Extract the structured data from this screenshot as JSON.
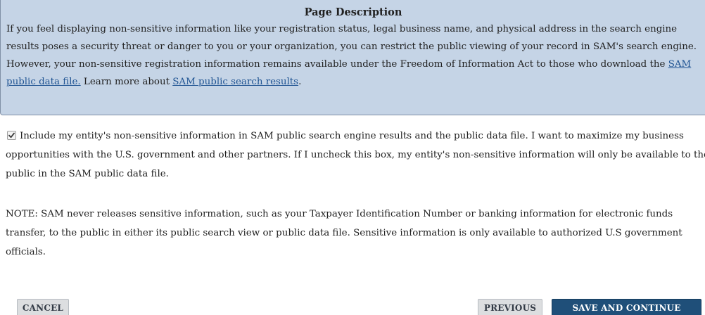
{
  "description": {
    "title": "Page Description",
    "text_1": "If you feel displaying non-sensitive information like your registration status, legal business name, and physical address in the search engine results poses a security threat or danger to you or your organization, you can restrict the public viewing of your record in SAM's search engine. However, your non-sensitive registration information remains available under the Freedom of Information Act to those who download the ",
    "link_data_file": "SAM public data file.",
    "text_2": " Learn more about ",
    "link_search_results": "SAM public search results",
    "text_3": "."
  },
  "consent": {
    "checked": true,
    "label": "Include my entity's non-sensitive information in SAM public search engine results and the public data file. I want to maximize my business opportunities with the U.S. government and other partners. If I uncheck this box, my entity's non-sensitive information will only be available to the public in the SAM public data file."
  },
  "note": "NOTE: SAM never releases sensitive information, such as your Taxpayer Identification Number or banking information for electronic funds transfer, to the public in either its public search view or public data file. Sensitive information is only available to authorized U.S government officials.",
  "buttons": {
    "cancel": "CANCEL",
    "previous": "PREVIOUS",
    "save_continue": "SAVE AND CONTINUE"
  },
  "colors": {
    "panel_bg": "#c5d4e6",
    "link": "#205493",
    "primary_button": "#1f4f79",
    "secondary_button": "#dcdee0"
  },
  "icons": {
    "checkbox": "checkmark-icon"
  }
}
